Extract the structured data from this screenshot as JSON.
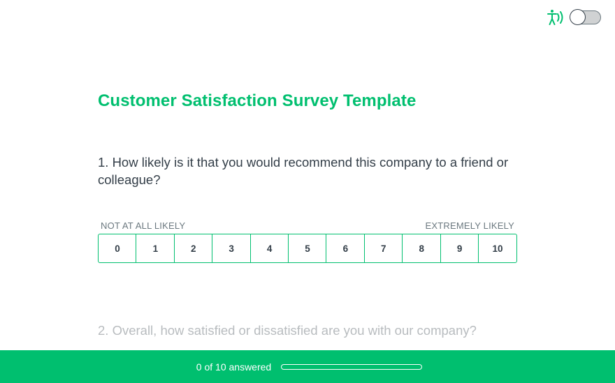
{
  "accessibility": {
    "icon": "accessibility-icon",
    "toggle_on": false
  },
  "survey": {
    "title": "Customer Satisfaction Survey Template"
  },
  "questions": [
    {
      "text": "1. How likely is it that you would recommend this company to a friend or colleague?",
      "scale_low_label": "NOT AT ALL LIKELY",
      "scale_high_label": "EXTREMELY LIKELY",
      "options": [
        "0",
        "1",
        "2",
        "3",
        "4",
        "5",
        "6",
        "7",
        "8",
        "9",
        "10"
      ]
    },
    {
      "text": "2. Overall, how satisfied or dissatisfied are you with our company?"
    }
  ],
  "progress": {
    "text": "0 of 10 answered",
    "answered": 0,
    "total": 10
  },
  "colors": {
    "accent": "#00bf6f",
    "text": "#333e48",
    "muted": "#b8bcbf"
  }
}
